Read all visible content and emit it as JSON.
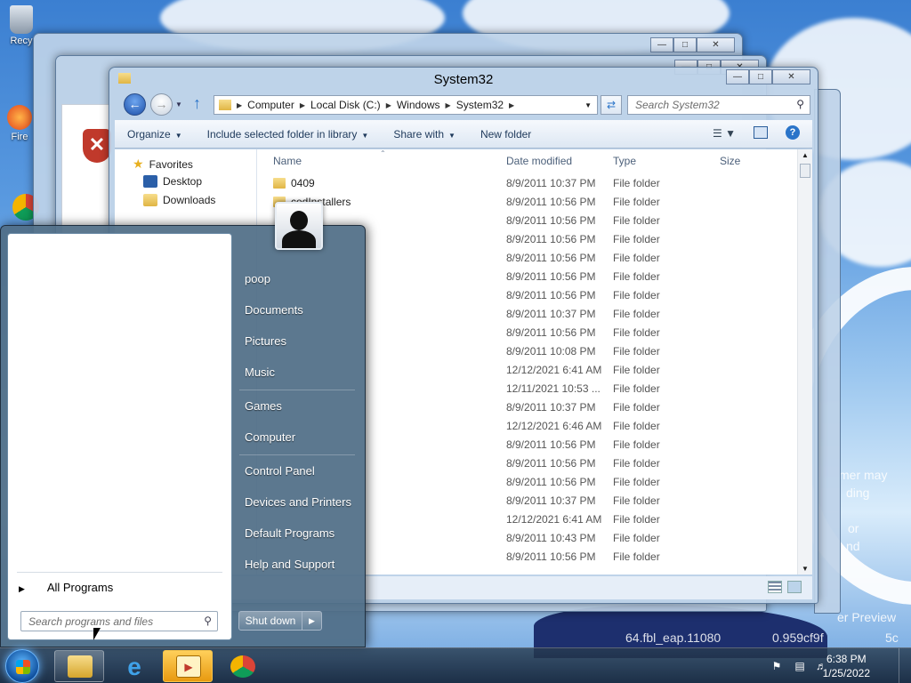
{
  "desktop": {
    "icons": [
      {
        "label": "Recy"
      },
      {
        "label": "Fire"
      }
    ],
    "wallpaper_text": [
      "mer may",
      "ding",
      "or",
      "nd",
      "er Preview",
      "64.fbl_eap.11080",
      "0.959cf9f",
      "5c"
    ]
  },
  "explorer": {
    "title": "System32",
    "breadcrumb": [
      "Computer",
      "Local Disk (C:)",
      "Windows",
      "System32"
    ],
    "search_placeholder": "Search System32",
    "toolbar": {
      "organize": "Organize",
      "include": "Include selected folder in library",
      "share": "Share with",
      "new_folder": "New folder"
    },
    "nav": {
      "favorites": "Favorites",
      "desktop": "Desktop",
      "downloads": "Downloads"
    },
    "columns": {
      "name": "Name",
      "date": "Date modified",
      "type": "Type",
      "size": "Size"
    },
    "rows": [
      {
        "name": "0409",
        "date": "8/9/2011 10:37 PM",
        "type": "File folder"
      },
      {
        "name": "cedInstallers",
        "date": "8/9/2011 10:56 PM",
        "type": "File folder"
      },
      {
        "name": "",
        "date": "8/9/2011 10:56 PM",
        "type": "File folder"
      },
      {
        "name": "",
        "date": "8/9/2011 10:56 PM",
        "type": "File folder"
      },
      {
        "name": "",
        "date": "8/9/2011 10:56 PM",
        "type": "File folder"
      },
      {
        "name": "",
        "date": "8/9/2011 10:56 PM",
        "type": "File folder"
      },
      {
        "name": "",
        "date": "8/9/2011 10:56 PM",
        "type": "File folder"
      },
      {
        "name": "",
        "date": "8/9/2011 10:37 PM",
        "type": "File folder"
      },
      {
        "name": "",
        "date": "8/9/2011 10:56 PM",
        "type": "File folder"
      },
      {
        "name": "",
        "date": "8/9/2011 10:08 PM",
        "type": "File folder"
      },
      {
        "name": "",
        "date": "12/12/2021 6:41 AM",
        "type": "File folder"
      },
      {
        "name": "",
        "date": "12/11/2021 10:53 ...",
        "type": "File folder"
      },
      {
        "name": "",
        "date": "8/9/2011 10:37 PM",
        "type": "File folder"
      },
      {
        "name": "",
        "date": "12/12/2021 6:46 AM",
        "type": "File folder"
      },
      {
        "name": "",
        "date": "8/9/2011 10:56 PM",
        "type": "File folder"
      },
      {
        "name": "",
        "date": "8/9/2011 10:56 PM",
        "type": "File folder"
      },
      {
        "name": "",
        "date": "8/9/2011 10:56 PM",
        "type": "File folder"
      },
      {
        "name": "",
        "date": "8/9/2011 10:37 PM",
        "type": "File folder"
      },
      {
        "name": "",
        "date": "12/12/2021 6:41 AM",
        "type": "File folder"
      },
      {
        "name": "",
        "date": "8/9/2011 10:43 PM",
        "type": "File folder"
      },
      {
        "name": "",
        "date": "8/9/2011 10:56 PM",
        "type": "File folder"
      }
    ]
  },
  "start_menu": {
    "right_items": [
      "poop",
      "Documents",
      "Pictures",
      "Music",
      "Games",
      "Computer",
      "Control Panel",
      "Devices and Printers",
      "Default Programs",
      "Help and Support"
    ],
    "all_programs": "All Programs",
    "search_placeholder": "Search programs and files",
    "shutdown": "Shut down"
  },
  "taskbar": {
    "time": "6:38 PM",
    "date": "1/25/2022"
  }
}
